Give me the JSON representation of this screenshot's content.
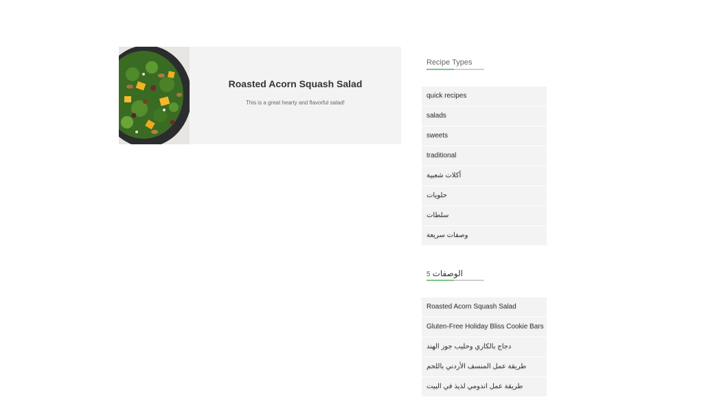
{
  "recipe_card": {
    "title": "Roasted Acorn Squash Salad",
    "description": "This is a great hearty and flavorful salad!"
  },
  "recipe_types": {
    "title": "Recipe Types",
    "items": [
      "quick recipes",
      "salads",
      "sweets",
      "traditional",
      "أكلات شعبية",
      "حلويات",
      "سلطات",
      "وصفات سريعة"
    ]
  },
  "recipes_widget": {
    "title": "الوصفات",
    "count": "5",
    "items": [
      "Roasted Acorn Squash Salad",
      "Gluten-Free Holiday Bliss Cookie Bars",
      "دجاج بالكاري وحليب جوز الهند",
      "طريقة عمل المنسف الأردني باللحم",
      "طريقة عمل اندومي لذيذ في البيت"
    ]
  },
  "colors": {
    "card_bg": "#f3f3f3",
    "accent_green": "#7cc68a"
  }
}
